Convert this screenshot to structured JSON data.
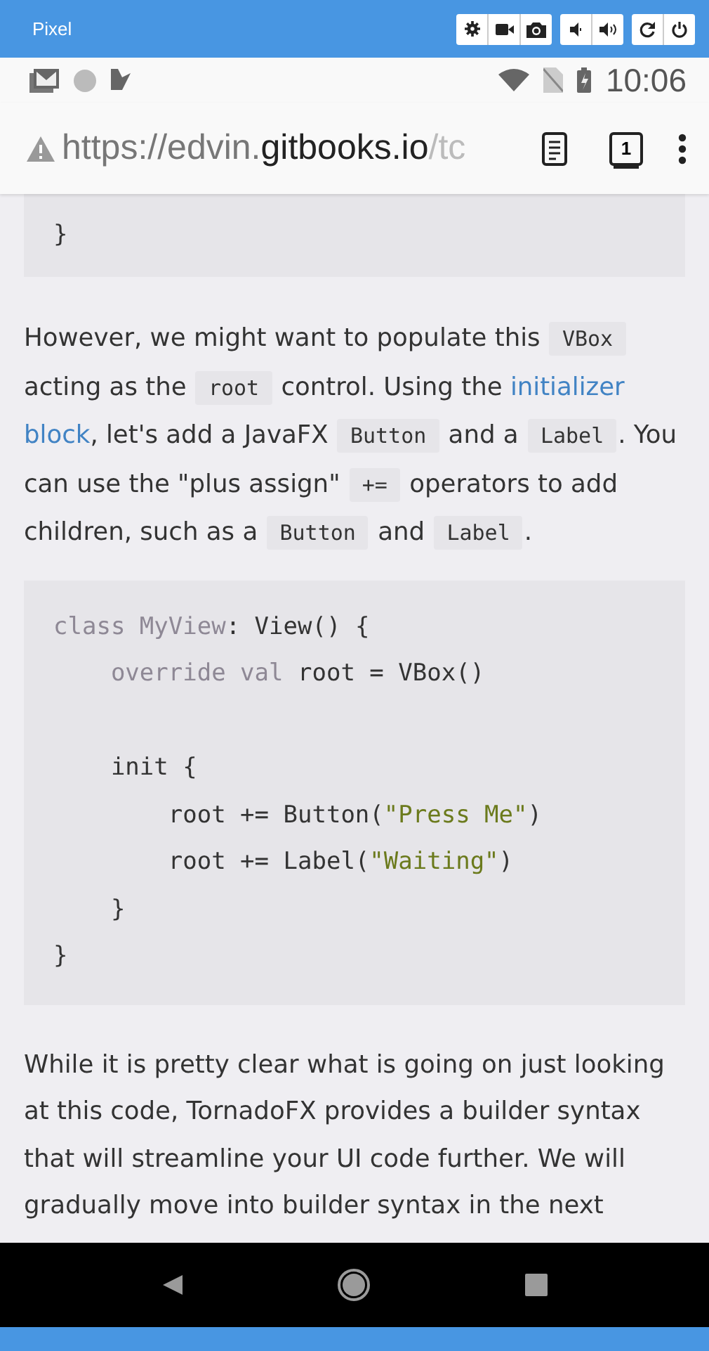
{
  "emulator": {
    "device": "Pixel"
  },
  "status_bar": {
    "time": "10:06"
  },
  "url_bar": {
    "scheme": "https://edvin.",
    "host": "gitbooks.io",
    "rest": "/tc",
    "tab_count": "1"
  },
  "code_tail": [
    "}"
  ],
  "paragraph_1": [
    {
      "kind": "text",
      "text": "However, we might want to populate this "
    },
    {
      "kind": "code",
      "text": "VBox"
    },
    {
      "kind": "text",
      "text": " acting as the "
    },
    {
      "kind": "code",
      "text": "root"
    },
    {
      "kind": "text",
      "text": " control. Using the "
    },
    {
      "kind": "link",
      "text": "initializer"
    },
    {
      "kind": "link",
      "text": "block"
    },
    {
      "kind": "text",
      "text": ", let's add a JavaFX "
    },
    {
      "kind": "code",
      "text": "Button"
    },
    {
      "kind": "text",
      "text": " and a "
    },
    {
      "kind": "code",
      "text": "Label"
    },
    {
      "kind": "text",
      "text": ". You can use the \"plus assign\" "
    },
    {
      "kind": "code",
      "text": "+="
    },
    {
      "kind": "text",
      "text": " operators to add children, such as a "
    },
    {
      "kind": "code",
      "text": "Button"
    },
    {
      "kind": "text",
      "text": " and "
    },
    {
      "kind": "code",
      "text": "Label"
    },
    {
      "kind": "text",
      "text": "."
    }
  ],
  "code_block": [
    [
      [
        {
          "kind": "keyword",
          "text": "class MyView"
        },
        {
          "kind": "plain",
          "text": ": View() {"
        }
      ],
      [
        {
          "kind": "keyword",
          "text": "    override val"
        },
        {
          "kind": "plain",
          "text": " root = VBox()"
        }
      ]
    ],
    [
      [
        {
          "kind": "plain",
          "text": "    init {"
        }
      ],
      [
        {
          "kind": "plain",
          "text": "        root += Button("
        },
        {
          "kind": "string",
          "text": "\"Press Me\""
        },
        {
          "kind": "plain",
          "text": ")"
        }
      ],
      [
        {
          "kind": "plain",
          "text": "        root += Label("
        },
        {
          "kind": "string",
          "text": "\"Waiting\""
        },
        {
          "kind": "plain",
          "text": ")"
        }
      ],
      [
        {
          "kind": "plain",
          "text": "    }"
        }
      ],
      [
        {
          "kind": "plain",
          "text": "}"
        }
      ]
    ]
  ],
  "paragraph_2": "While it is pretty clear what is going on just looking at this code, TornadoFX provides a builder syntax that will streamline your UI code further. We will gradually move into builder syntax in the next"
}
